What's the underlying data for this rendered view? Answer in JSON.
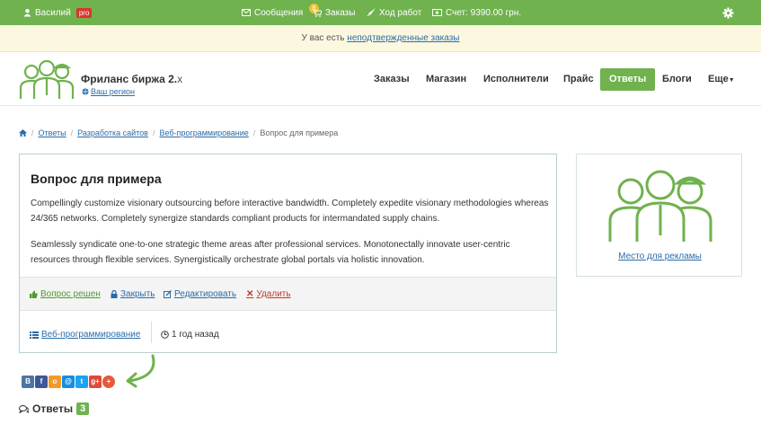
{
  "topbar": {
    "user": "Василий",
    "pro": "pro",
    "messages": "Сообщения",
    "orders_badge": "8",
    "orders": "Заказы",
    "progress": "Ход работ",
    "balance": "Счет: 9390.00 грн."
  },
  "notice": {
    "prefix": "У вас есть",
    "link": "неподтвержденные заказы"
  },
  "header": {
    "brand": "Фриланс биржа 2.",
    "brand_suffix": "x",
    "region": "Ваш регион",
    "nav": [
      "Заказы",
      "Магазин",
      "Исполнители",
      "Прайс",
      "Ответы",
      "Блоги",
      "Еще"
    ]
  },
  "breadcrumb": {
    "items": [
      "Ответы",
      "Разработка сайтов",
      "Веб-программирование"
    ],
    "current": "Вопрос для примера"
  },
  "question": {
    "title": "Вопрос для примера",
    "p1": "Compellingly customize visionary outsourcing before interactive bandwidth. Completely expedite visionary methodologies whereas 24/365 networks. Completely synergize standards compliant products for intermandated supply chains.",
    "p2": "Seamlessly syndicate one-to-one strategic theme areas after professional services. Monotonectally innovate user-centric resources through flexible services. Synergistically orchestrate global portals via holistic innovation.",
    "actions": {
      "solved": "Вопрос решен",
      "close": "Закрыть",
      "edit": "Редактировать",
      "delete": "Удалить"
    },
    "category": "Веб-программирование",
    "time": "1 год назад"
  },
  "ad": {
    "link": "Место для рекламы"
  },
  "share": [
    "В",
    "f",
    "о",
    "@",
    "t",
    "g+",
    "+"
  ],
  "answers": {
    "label": "Ответы",
    "count": "3"
  },
  "colors": {
    "green": "#6fb24e",
    "link": "#2a6ca8",
    "red": "#c0392b"
  }
}
